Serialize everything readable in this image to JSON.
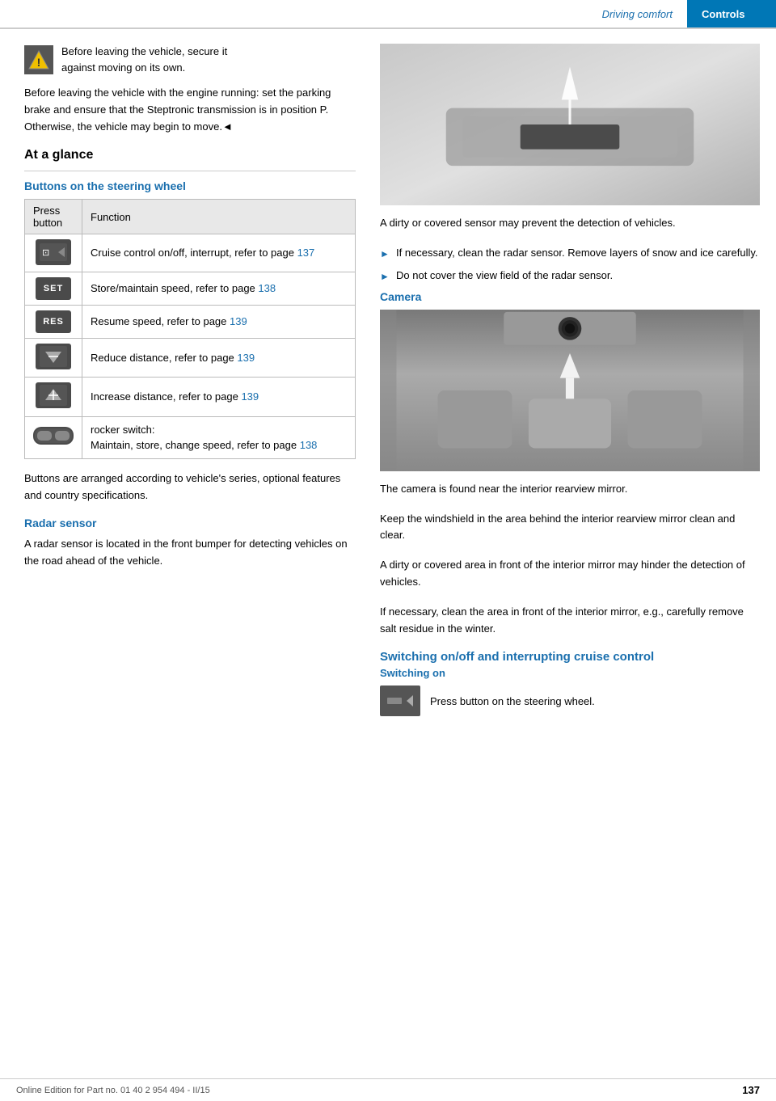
{
  "header": {
    "driving_comfort": "Driving comfort",
    "controls": "Controls"
  },
  "warning": {
    "text_line1": "Before leaving the vehicle, secure it",
    "text_line2": "against moving on its own."
  },
  "body_warning": "Before leaving the vehicle with the engine running: set the parking brake and ensure that the Steptronic transmission is in position P. Otherwise, the vehicle may begin to move.◄",
  "at_a_glance": {
    "heading": "At a glance"
  },
  "steering_table": {
    "heading": "Buttons on the steering wheel",
    "col1": "Press button",
    "col2": "Function",
    "rows": [
      {
        "btn_label": "cruise",
        "function_text": "Cruise control on/off, interrupt, refer to page ",
        "page_ref": "137"
      },
      {
        "btn_label": "SET",
        "function_text": "Store/maintain speed, refer to page ",
        "page_ref": "138"
      },
      {
        "btn_label": "RES",
        "function_text": "Resume speed, refer to page ",
        "page_ref": "139"
      },
      {
        "btn_label": "reduce",
        "function_text": "Reduce distance, refer to page ",
        "page_ref": "139"
      },
      {
        "btn_label": "increase",
        "function_text": "Increase distance, refer to page ",
        "page_ref": "139"
      },
      {
        "btn_label": "rocker",
        "function_text1": "rocker switch:",
        "function_text2": "Maintain, store, change speed, refer to page ",
        "page_ref": "138"
      }
    ]
  },
  "buttons_note": "Buttons are arranged according to vehicle's series, optional features and country specifications.",
  "radar_sensor": {
    "heading": "Radar sensor",
    "text": "A radar sensor is located in the front bumper for detecting vehicles on the road ahead of the vehicle.",
    "dirty_sensor_text": "A dirty or covered sensor may prevent the detection of vehicles.",
    "bullets": [
      "If necessary, clean the radar sensor. Remove layers of snow and ice carefully.",
      "Do not cover the view field of the radar sensor."
    ]
  },
  "camera": {
    "heading": "Camera",
    "text1": "The camera is found near the interior rearview mirror.",
    "text2": "Keep the windshield in the area behind the interior rearview mirror clean and clear.",
    "text3": "A dirty or covered area in front of the interior mirror may hinder the detection of vehicles.",
    "text4": "If necessary, clean the area in front of the interior mirror, e.g., carefully remove salt residue in the winter."
  },
  "switching": {
    "main_heading": "Switching on/off and interrupting cruise control",
    "sub_heading": "Switching on",
    "press_text": "Press button on the steering wheel."
  },
  "footer": {
    "text": "Online Edition for Part no. 01 40 2 954 494 - II/15",
    "page": "137"
  }
}
